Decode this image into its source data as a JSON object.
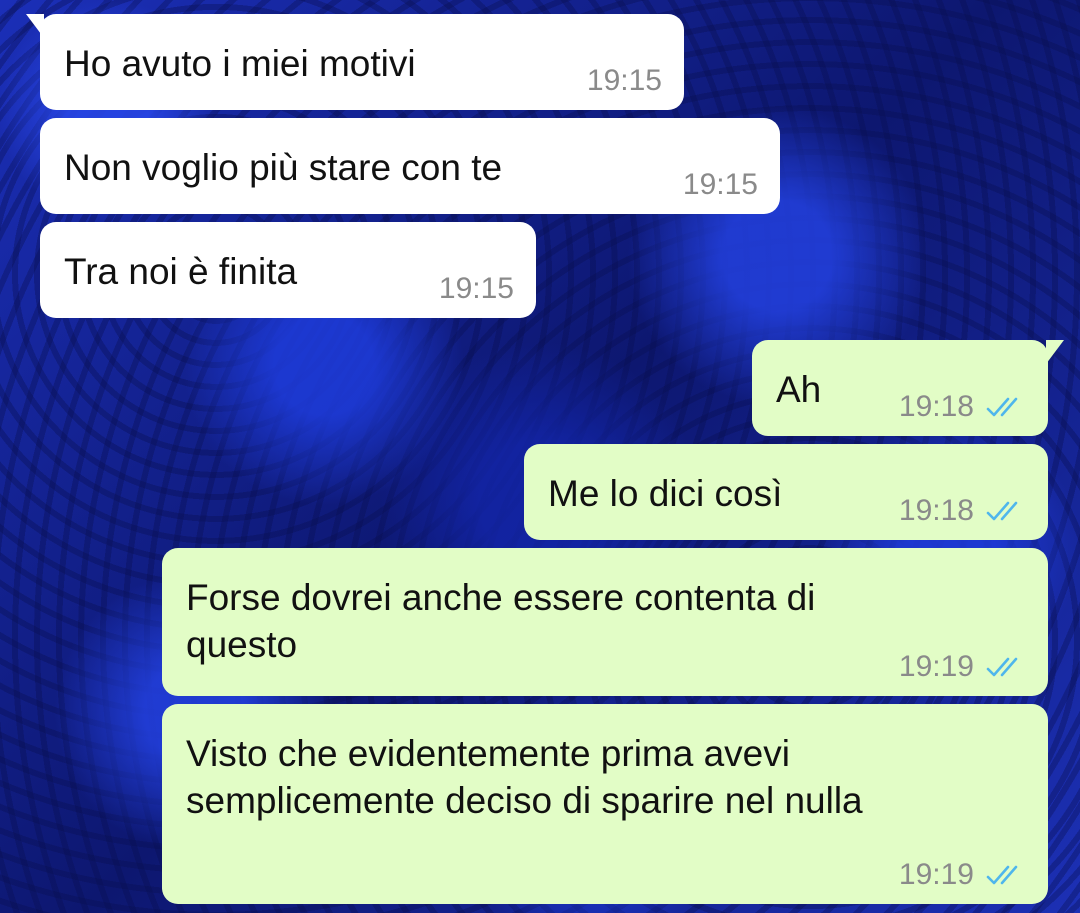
{
  "colors": {
    "incoming_bubble": "#ffffff",
    "outgoing_bubble": "#e2fdc6",
    "read_ticks": "#4fb6ec",
    "timestamp": "#8a8a8a",
    "wallpaper": "#1a2a9e"
  },
  "messages": [
    {
      "direction": "in",
      "text": "Ho avuto i miei motivi",
      "time": "19:15"
    },
    {
      "direction": "in",
      "text": "Non voglio più stare con te",
      "time": "19:15"
    },
    {
      "direction": "in",
      "text": "Tra noi è finita",
      "time": "19:15"
    },
    {
      "direction": "out",
      "text": "Ah",
      "time": "19:18",
      "status_icon": "double-check-read-icon"
    },
    {
      "direction": "out",
      "text": "Me lo dici così",
      "time": "19:18",
      "status_icon": "double-check-read-icon"
    },
    {
      "direction": "out",
      "text": "Forse dovrei anche essere contenta di\nquesto",
      "time": "19:19",
      "status_icon": "double-check-read-icon"
    },
    {
      "direction": "out",
      "text": "Visto che evidentemente prima avevi\nsemplicemente deciso di sparire nel nulla",
      "time": "19:19",
      "status_icon": "double-check-read-icon"
    }
  ]
}
